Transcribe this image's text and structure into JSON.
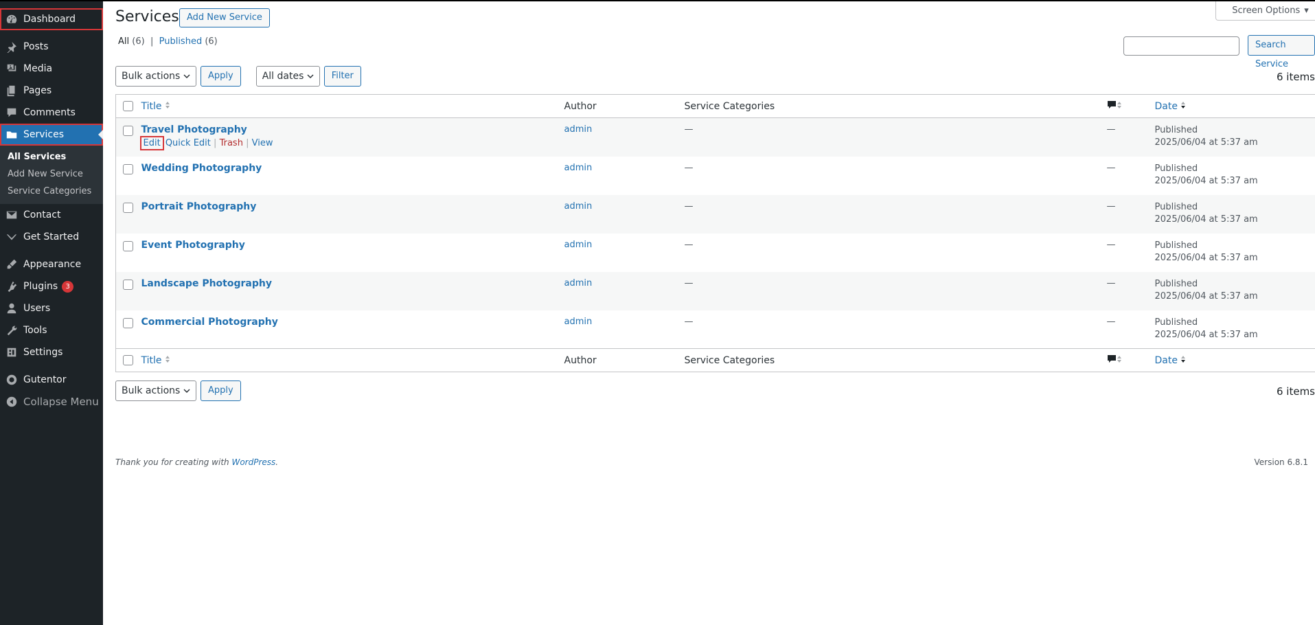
{
  "sidebar": {
    "items": [
      {
        "label": "Dashboard",
        "icon": "dashboard-icon"
      },
      {
        "label": "Posts",
        "icon": "pin-icon"
      },
      {
        "label": "Media",
        "icon": "media-icon"
      },
      {
        "label": "Pages",
        "icon": "pages-icon"
      },
      {
        "label": "Comments",
        "icon": "comments-icon"
      },
      {
        "label": "Services",
        "icon": "folder-icon"
      },
      {
        "label": "Contact",
        "icon": "mail-icon"
      },
      {
        "label": "Get Started",
        "icon": "chevron-down-icon"
      },
      {
        "label": "Appearance",
        "icon": "paintbrush-icon"
      },
      {
        "label": "Plugins",
        "icon": "plugin-icon",
        "badge": "3"
      },
      {
        "label": "Users",
        "icon": "user-icon"
      },
      {
        "label": "Tools",
        "icon": "wrench-icon"
      },
      {
        "label": "Settings",
        "icon": "settings-icon"
      },
      {
        "label": "Gutentor",
        "icon": "gutentor-icon"
      },
      {
        "label": "Collapse Menu",
        "icon": "collapse-icon"
      }
    ],
    "submenu": [
      "All Services",
      "Add New Service",
      "Service Categories"
    ]
  },
  "header": {
    "title": "Services",
    "add_new": "Add New Service",
    "screen_options": "Screen Options"
  },
  "views": {
    "all": "All",
    "all_count": "(6)",
    "sep": "|",
    "published": "Published",
    "published_count": "(6)"
  },
  "search": {
    "button": "Search Service",
    "value": ""
  },
  "tablenav": {
    "bulk": "Bulk actions",
    "apply": "Apply",
    "dates": "All dates",
    "filter": "Filter",
    "items": "6 items"
  },
  "columns": {
    "title": "Title",
    "author": "Author",
    "categories": "Service Categories",
    "date": "Date"
  },
  "row_actions": {
    "edit": "Edit",
    "quick_edit": "Quick Edit",
    "trash": "Trash",
    "view": "View",
    "sep": "|"
  },
  "rows": [
    {
      "title": "Travel Photography",
      "author": "admin",
      "categories": "—",
      "comments": "—",
      "status": "Published",
      "date": "2025/06/04 at 5:37 am"
    },
    {
      "title": "Wedding Photography",
      "author": "admin",
      "categories": "—",
      "comments": "—",
      "status": "Published",
      "date": "2025/06/04 at 5:37 am"
    },
    {
      "title": "Portrait Photography",
      "author": "admin",
      "categories": "—",
      "comments": "—",
      "status": "Published",
      "date": "2025/06/04 at 5:37 am"
    },
    {
      "title": "Event Photography",
      "author": "admin",
      "categories": "—",
      "comments": "—",
      "status": "Published",
      "date": "2025/06/04 at 5:37 am"
    },
    {
      "title": "Landscape Photography",
      "author": "admin",
      "categories": "—",
      "comments": "—",
      "status": "Published",
      "date": "2025/06/04 at 5:37 am"
    },
    {
      "title": "Commercial Photography",
      "author": "admin",
      "categories": "—",
      "comments": "—",
      "status": "Published",
      "date": "2025/06/04 at 5:37 am"
    }
  ],
  "footer": {
    "thanks_prefix": "Thank you for creating with",
    "wordpress": "WordPress",
    "thanks_suffix": ".",
    "version": "Version 6.8.1"
  },
  "colors": {
    "accent": "#2271b1",
    "sidebar": "#1d2327",
    "highlight": "#d63638"
  }
}
